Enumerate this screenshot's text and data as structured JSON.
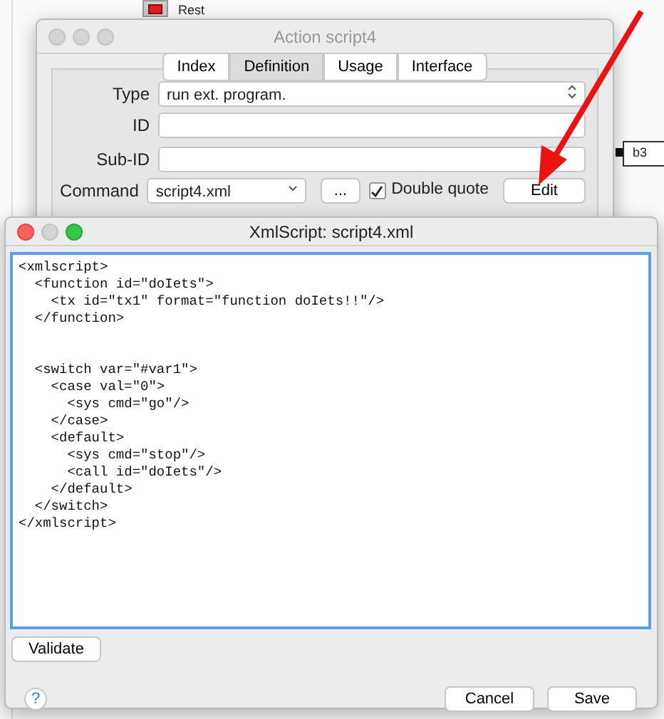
{
  "canvas": {
    "reset_node": {
      "label": "Rest"
    },
    "b3_node": {
      "label": "b3"
    }
  },
  "action_window": {
    "title": "Action script4",
    "tabs": [
      {
        "label": "Index",
        "selected": false
      },
      {
        "label": "Definition",
        "selected": true
      },
      {
        "label": "Usage",
        "selected": false
      },
      {
        "label": "Interface",
        "selected": false
      }
    ],
    "type": {
      "label": "Type",
      "value": "run ext. program."
    },
    "id": {
      "label": "ID"
    },
    "sub_id": {
      "label": "Sub-ID"
    },
    "command": {
      "label": "Command",
      "value": "script4.xml",
      "browse_button": "...",
      "double_quote": {
        "label": "Double quote",
        "checked": true
      },
      "edit_button": "Edit"
    }
  },
  "xml_window": {
    "title": "XmlScript: script4.xml",
    "code": "<xmlscript>\n  <function id=\"doIets\">\n    <tx id=\"tx1\" format=\"function doIets!!\"/>\n  </function>\n\n\n  <switch var=\"#var1\">\n    <case val=\"0\">\n      <sys cmd=\"go\"/>\n    </case>\n    <default>\n      <sys cmd=\"stop\"/>\n      <call id=\"doIets\"/>\n    </default>\n  </switch>\n</xmlscript>",
    "validate_button": "Validate",
    "help_button": "?",
    "cancel_button": "Cancel",
    "save_button": "Save"
  }
}
